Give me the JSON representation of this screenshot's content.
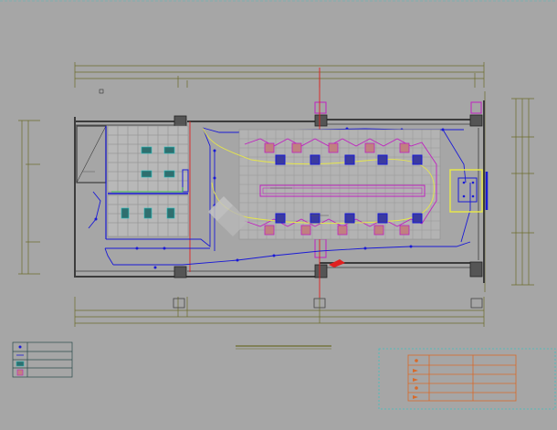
{
  "drawing": {
    "background": "#a6a6a6",
    "colors": {
      "wall": "#3c3c3c",
      "dimension": "#6b6b2a",
      "wiring": "#1a1ad6",
      "magenta": "#c020c0",
      "yellow": "#e6e64a",
      "red": "#e02020",
      "green": "#20c040",
      "orange_table": "#d86a2a",
      "frame_cyan": "#3cc0c0"
    },
    "fixture_icons": [
      "down-light",
      "grille-light",
      "panel-light",
      "square-spot"
    ],
    "legend_rows": 4,
    "material_table_rows": 4
  }
}
